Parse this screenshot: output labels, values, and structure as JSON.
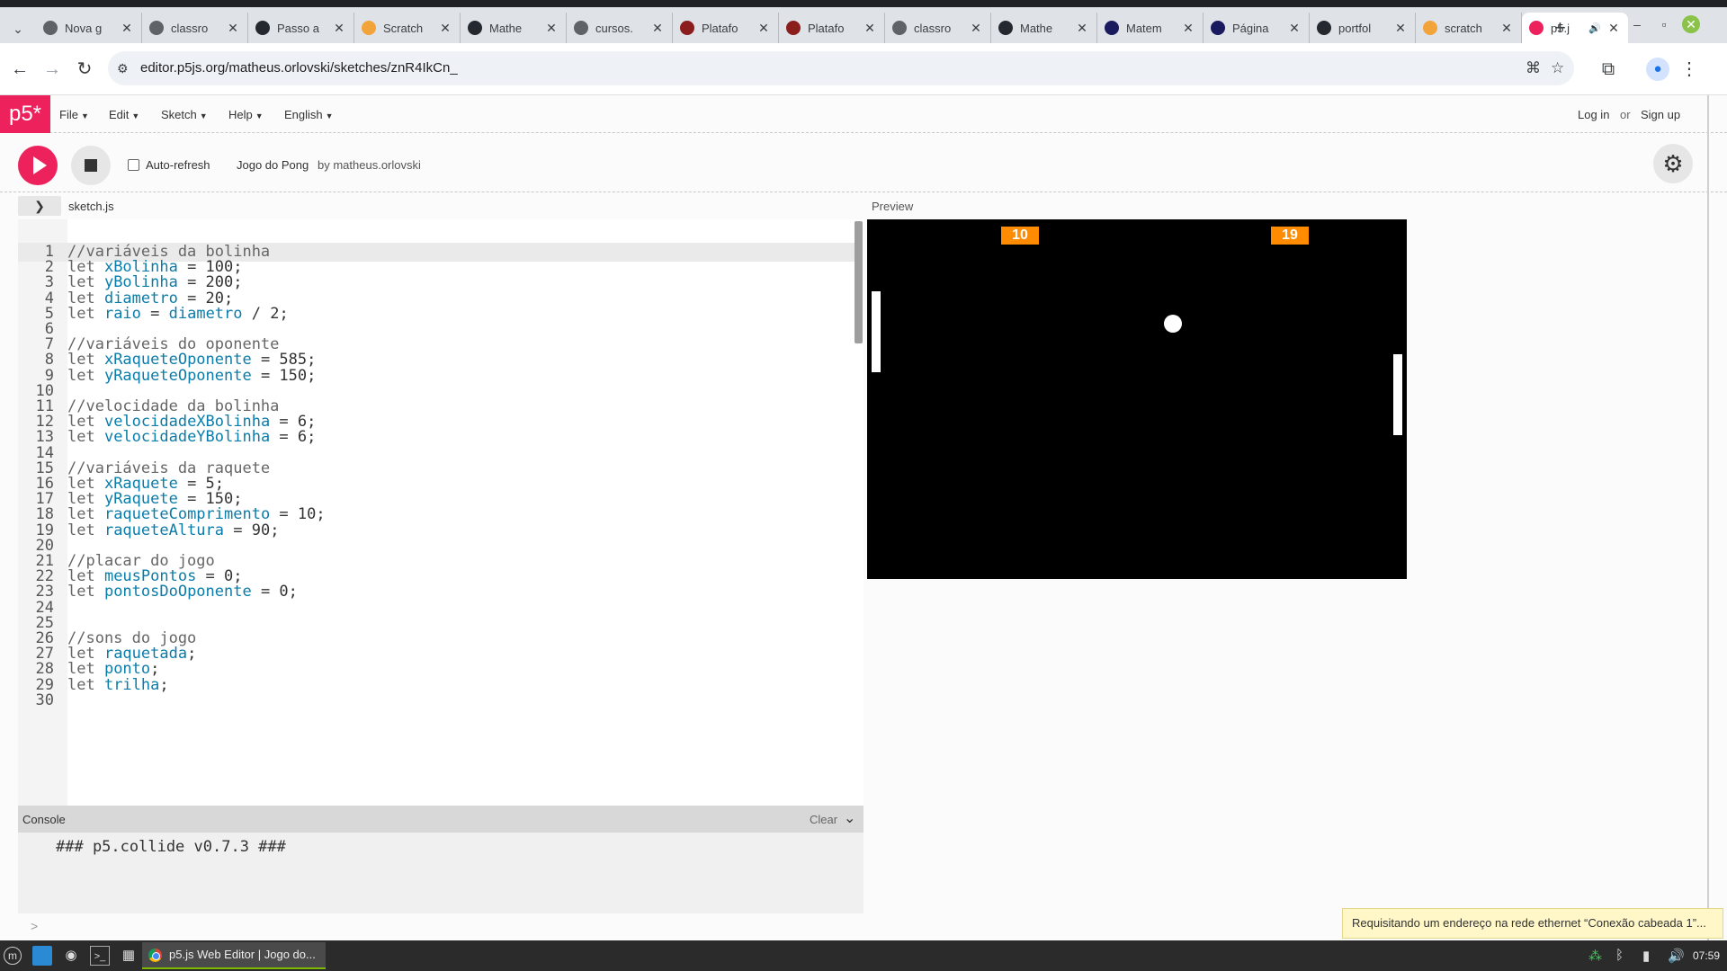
{
  "browser": {
    "tabs": [
      {
        "title": "Nova g",
        "color": "#5f6368",
        "icon": "globe-icon"
      },
      {
        "title": "classro",
        "color": "#5f6368",
        "icon": "globe-icon"
      },
      {
        "title": "Passo a",
        "color": "#24292f",
        "icon": "github-icon"
      },
      {
        "title": "Scratch",
        "color": "#f2a33a",
        "icon": "bitcoin-icon"
      },
      {
        "title": "Mathe",
        "color": "#24292f",
        "icon": "github-icon"
      },
      {
        "title": "cursos.",
        "color": "#5f6368",
        "icon": "globe-icon"
      },
      {
        "title": "Platafo",
        "color": "#8b1d1d",
        "icon": "shield-icon"
      },
      {
        "title": "Platafo",
        "color": "#8b1d1d",
        "icon": "shield-icon"
      },
      {
        "title": "classro",
        "color": "#5f6368",
        "icon": "image-icon"
      },
      {
        "title": "Mathe",
        "color": "#24292f",
        "icon": "github-icon"
      },
      {
        "title": "Matem",
        "color": "#1a1a5e",
        "icon": "a-icon"
      },
      {
        "title": "Página",
        "color": "#1a1a5e",
        "icon": "a-icon"
      },
      {
        "title": "portfol",
        "color": "#24292f",
        "icon": "github-icon"
      },
      {
        "title": "scratch",
        "color": "#f2a33a",
        "icon": "bitcoin-icon"
      },
      {
        "title": "p5.j",
        "color": "#ed225d",
        "icon": "p5-asterisk-icon"
      }
    ],
    "url": "editor.p5js.org/matheus.orlovski/sketches/znR4IkCn_"
  },
  "p5": {
    "logo": "p5*",
    "menu": [
      "File",
      "Edit",
      "Sketch",
      "Help",
      "English"
    ],
    "login": "Log in",
    "or": "or",
    "signup": "Sign up",
    "auto_refresh": "Auto-refresh",
    "sketch_name": "Jogo do Pong",
    "byline": "by matheus.orlovski",
    "filename": "sketch.js",
    "preview_label": "Preview"
  },
  "code_lines": [
    "//variáveis da bolinha",
    "let xBolinha = 100;",
    "let yBolinha = 200;",
    "let diametro = 20;",
    "let raio = diametro / 2;",
    "",
    "//variáveis do oponente",
    "let xRaqueteOponente = 585;",
    "let yRaqueteOponente = 150;",
    "",
    "//velocidade da bolinha",
    "let velocidadeXBolinha = 6;",
    "let velocidadeYBolinha = 6;",
    "",
    "//variáveis da raquete",
    "let xRaquete = 5;",
    "let yRaquete = 150;",
    "let raqueteComprimento = 10;",
    "let raqueteAltura = 90;",
    "",
    "//placar do jogo",
    "let meusPontos = 0;",
    "let pontosDoOponente = 0;",
    "",
    "",
    "//sons do jogo",
    "let raquetada;",
    "let ponto;",
    "let trilha;",
    ""
  ],
  "console": {
    "label": "Console",
    "clear": "Clear",
    "message": "### p5.collide v0.7.3 ###",
    "prompt": ">"
  },
  "game": {
    "player_score": "10",
    "opponent_score": "19",
    "accent": "#ff8c00"
  },
  "notification": "Requisitando um endereço na rede ethernet “Conexão cabeada 1”...",
  "taskbar": {
    "task_title": "p5.js Web Editor | Jogo do...",
    "clock": "07:59"
  }
}
